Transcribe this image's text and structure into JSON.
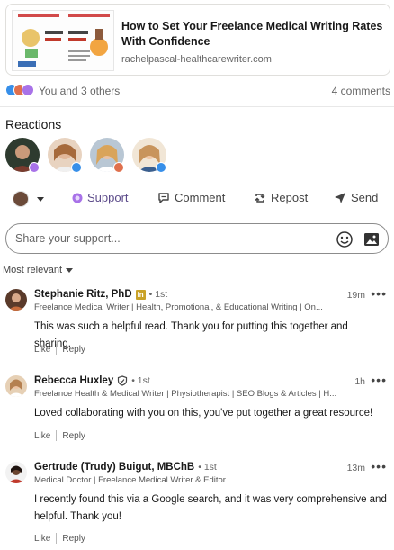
{
  "link_preview": {
    "title": "How to Set Your Freelance Medical Writing Rates With Confidence",
    "domain": "rachelpascal-healthcarewriter.com"
  },
  "social": {
    "reactors_text": "You and 3 others",
    "comments_count": "4 comments"
  },
  "reactions": {
    "title": "Reactions"
  },
  "actions": {
    "support": "Support",
    "comment": "Comment",
    "repost": "Repost",
    "send": "Send"
  },
  "compose": {
    "placeholder": "Share your support..."
  },
  "sort": {
    "label": "Most relevant"
  },
  "comments": [
    {
      "name": "Stephanie Ritz, PhD",
      "degree": "• 1st",
      "headline": "Freelance Medical Writer | Health, Promotional, & Educational Writing | On...",
      "time": "19m",
      "text": "This was such a helpful read. Thank you for putting this together and sharing.",
      "like": "Like",
      "reply": "Reply"
    },
    {
      "name": "Rebecca Huxley",
      "degree": "• 1st",
      "headline": "Freelance Health & Medical Writer | Physiotherapist | SEO Blogs & Articles | H...",
      "time": "1h",
      "text": "Loved collaborating with you on this, you've put together a great resource!",
      "like": "Like",
      "reply": "Reply"
    },
    {
      "name": "Gertrude (Trudy) Buigut, MBChB",
      "degree": "• 1st",
      "headline": "Medical Doctor | Freelance Medical Writer & Editor",
      "time": "13m",
      "text": "I recently found this via a Google search, and it was very comprehensive and helpful. Thank you!",
      "like": "Like",
      "reply": "Reply"
    }
  ],
  "colors": {
    "like_blue": "#378fe9",
    "love_red": "#df704d",
    "support_purple": "#a872e8",
    "linkedin_badge": "#0a66c2"
  }
}
